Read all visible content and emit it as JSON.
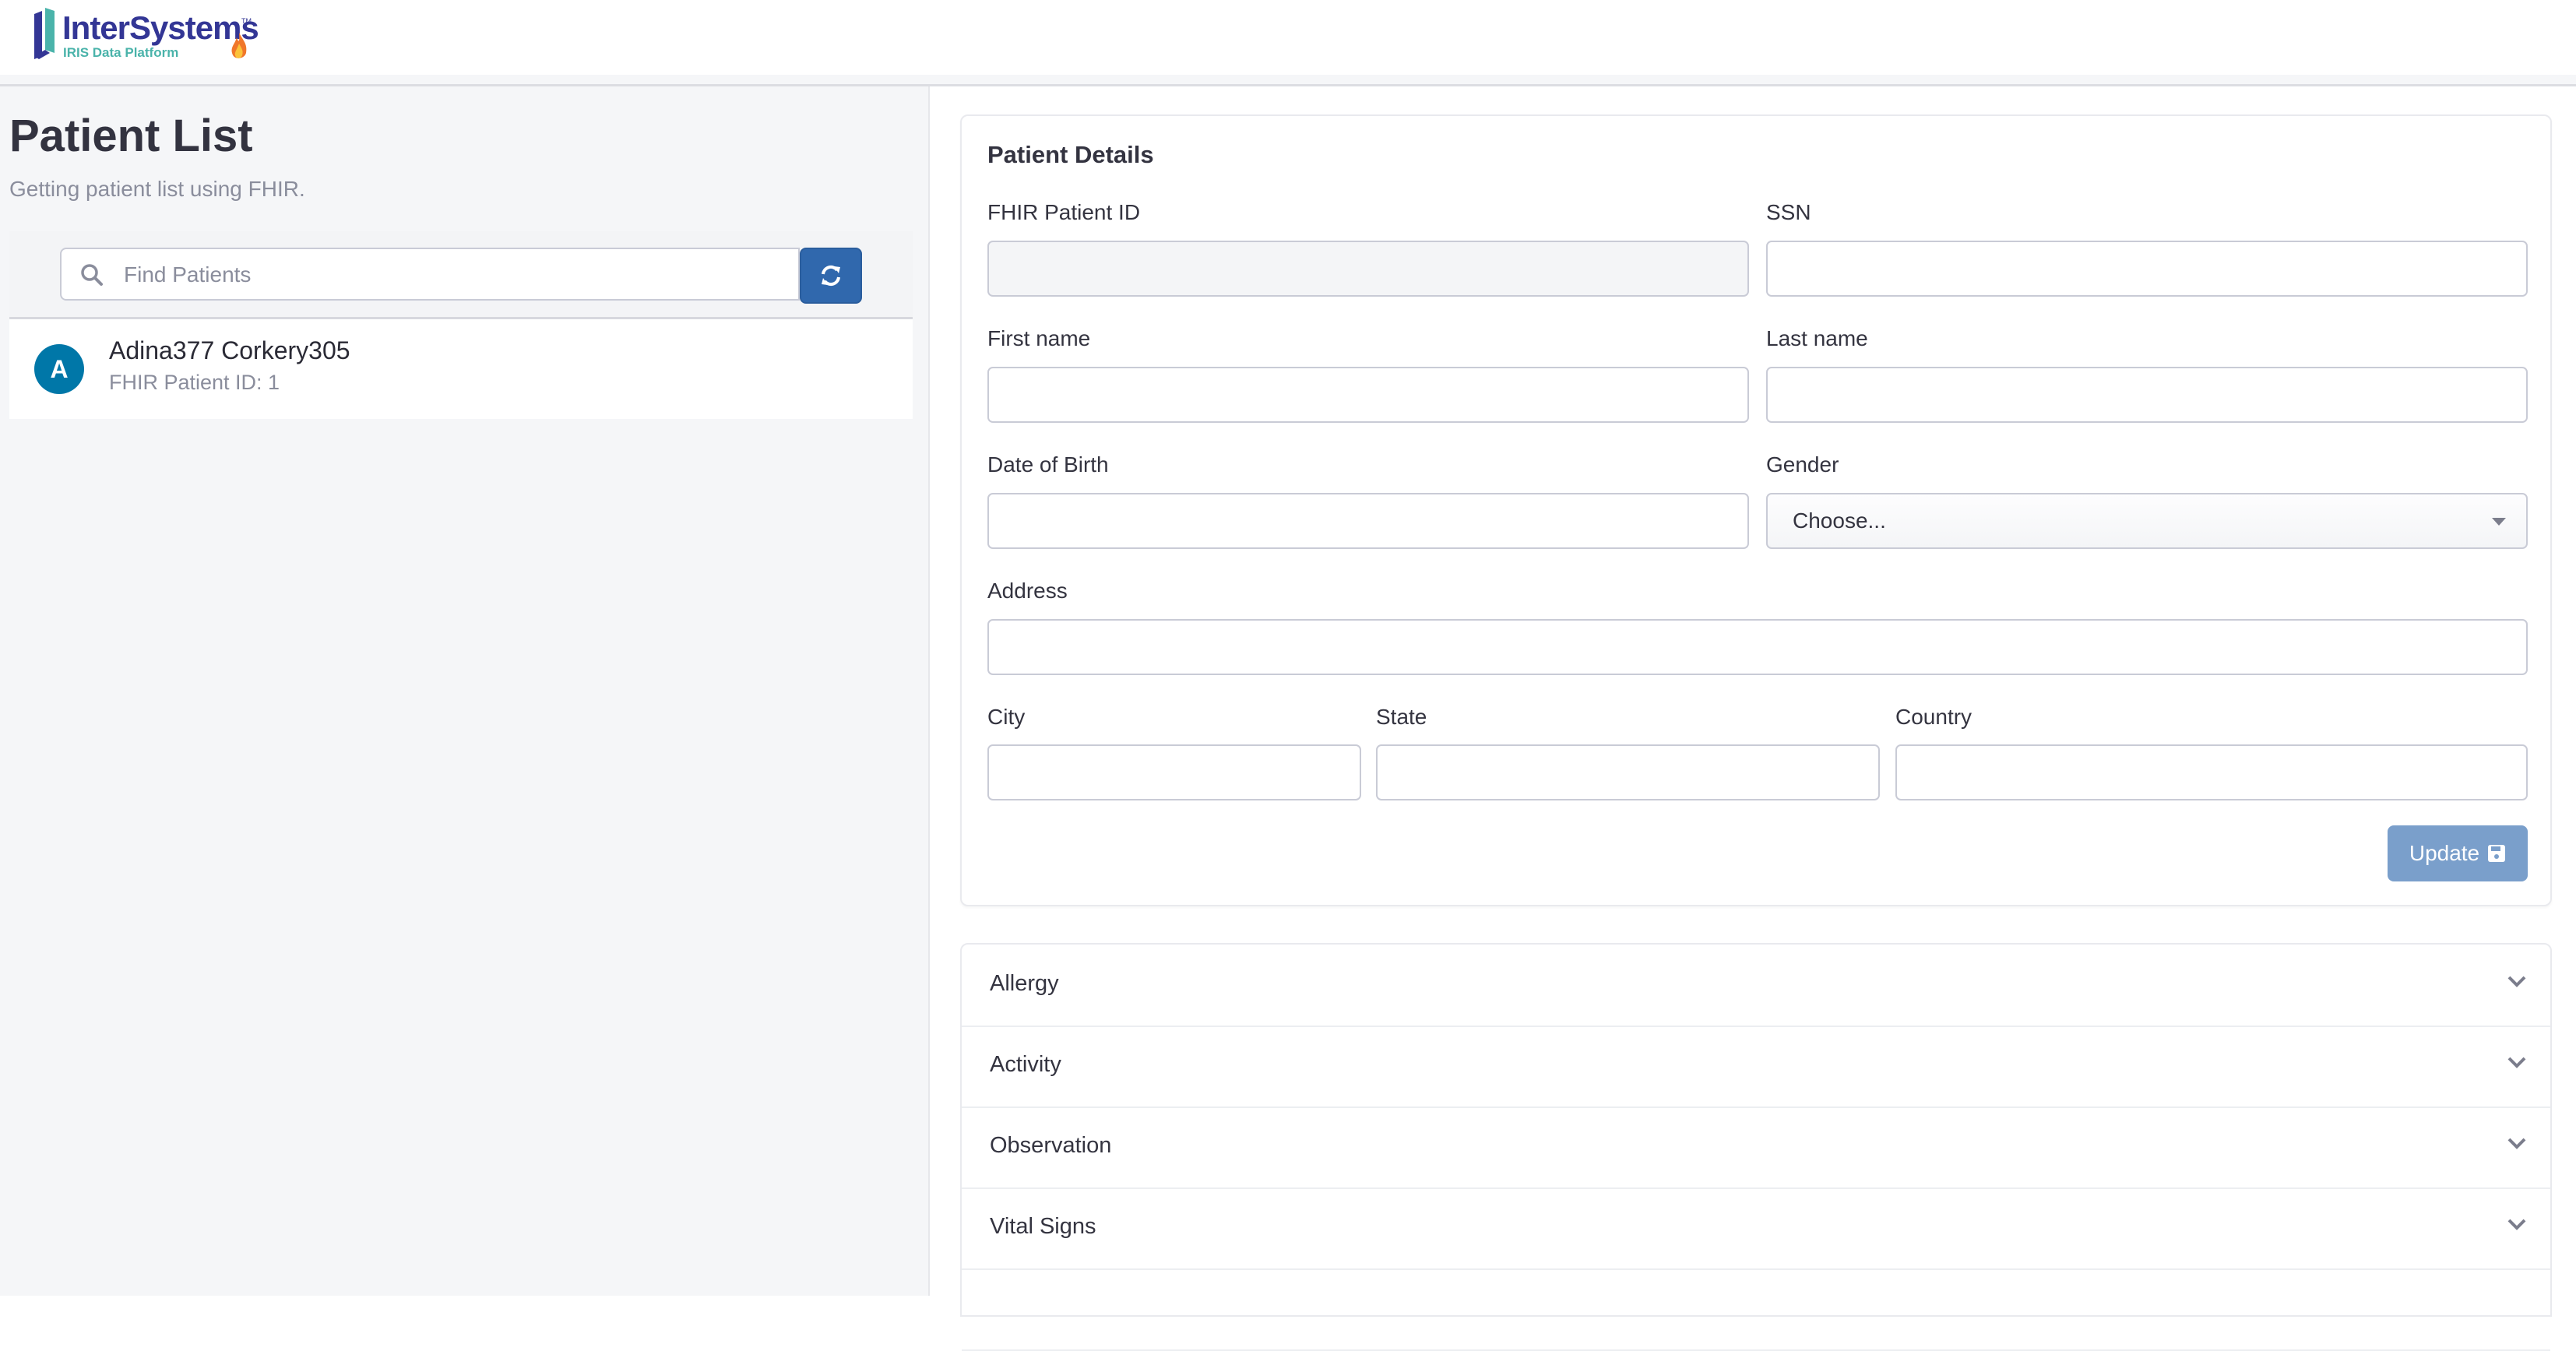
{
  "brand": {
    "name": "InterSystems",
    "tm": "TM",
    "product": "IRIS Data Platform",
    "colors": {
      "primary": "#333695",
      "teal": "#4ab3aa"
    }
  },
  "sidebar": {
    "title": "Patient List",
    "subtitle": "Getting patient list using FHIR.",
    "search": {
      "placeholder": "Find Patients",
      "value": ""
    },
    "refresh_icon": "refresh-icon",
    "patients": [
      {
        "avatar_letter": "A",
        "name": "Adina377 Corkery305",
        "id_text": "FHIR Patient ID: 1"
      }
    ]
  },
  "details": {
    "title": "Patient Details",
    "fields": {
      "fhir_id": {
        "label": "FHIR Patient ID",
        "value": ""
      },
      "ssn": {
        "label": "SSN",
        "value": ""
      },
      "first_name": {
        "label": "First name",
        "value": ""
      },
      "last_name": {
        "label": "Last name",
        "value": ""
      },
      "dob": {
        "label": "Date of Birth",
        "value": ""
      },
      "gender": {
        "label": "Gender",
        "selected": "Choose..."
      },
      "address": {
        "label": "Address",
        "value": ""
      },
      "city": {
        "label": "City",
        "value": ""
      },
      "state": {
        "label": "State",
        "value": ""
      },
      "country": {
        "label": "Country",
        "value": ""
      }
    },
    "update_label": "Update",
    "update_icon": "floppy-disk-icon"
  },
  "accordion": {
    "items": [
      {
        "label": "Allergy"
      },
      {
        "label": "Activity"
      },
      {
        "label": "Observation"
      },
      {
        "label": "Vital Signs"
      },
      {
        "label": ""
      }
    ]
  },
  "colors": {
    "accent": "#3068ad",
    "avatar": "#0077a8",
    "update_button": "#7a9fcb"
  }
}
